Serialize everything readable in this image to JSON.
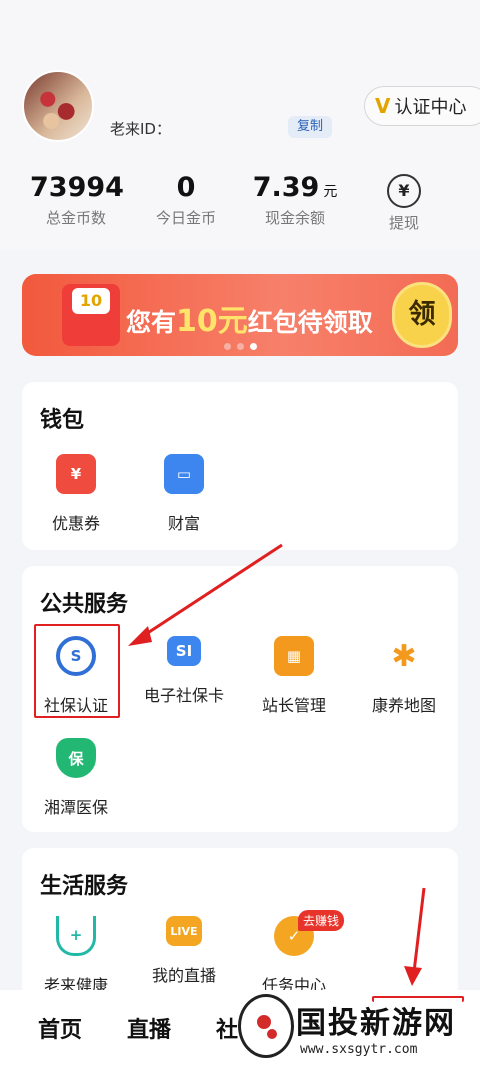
{
  "profile": {
    "user_id_label": "老来ID：",
    "copy_label": "复制",
    "verify_icon": "V",
    "verify_label": "认证中心"
  },
  "stats": [
    {
      "value": "73994",
      "label": "总金币数"
    },
    {
      "value": "0",
      "label": "今日金币"
    },
    {
      "value": "7.39",
      "unit": "元",
      "label": "现金余额"
    },
    {
      "icon": "yen-withdraw-icon",
      "label": "提现"
    }
  ],
  "banner": {
    "coin_text": "10",
    "text_prefix": "您有",
    "amount": "10元",
    "text_suffix": "红包待领取",
    "button_label": "领"
  },
  "wallet": {
    "title": "钱包",
    "items": [
      {
        "label": "优惠券",
        "icon": "coupon-icon",
        "color": "#ef4b3f"
      },
      {
        "label": "财富",
        "icon": "wallet-icon",
        "color": "#3d86ef"
      }
    ]
  },
  "public_services": {
    "title": "公共服务",
    "items": [
      {
        "label": "社保认证",
        "icon": "social-security-icon",
        "color": "#2f6fd6"
      },
      {
        "label": "电子社保卡",
        "icon": "si-card-icon",
        "color": "#3d86ef"
      },
      {
        "label": "站长管理",
        "icon": "grid-manage-icon",
        "color": "#f39a1e"
      },
      {
        "label": "康养地图",
        "icon": "map-figure-icon",
        "color": "#f39a1e"
      },
      {
        "label": "湘潭医保",
        "icon": "medical-shield-icon",
        "color": "#22b873"
      }
    ]
  },
  "life_services": {
    "title": "生活服务",
    "items": [
      {
        "label": "老来健康",
        "icon": "health-plus-icon",
        "color": "#22b8a6"
      },
      {
        "label": "我的直播",
        "icon": "live-tv-icon",
        "color": "#f4a623"
      },
      {
        "label": "任务中心",
        "icon": "task-clipboard-icon",
        "color": "#f4a623"
      }
    ],
    "earn_tag": "去赚钱"
  },
  "tabbar": {
    "tabs": [
      "首页",
      "直播",
      "社"
    ]
  },
  "watermark": {
    "name": "国投新游网",
    "url": "www.sxsgytr.com"
  }
}
